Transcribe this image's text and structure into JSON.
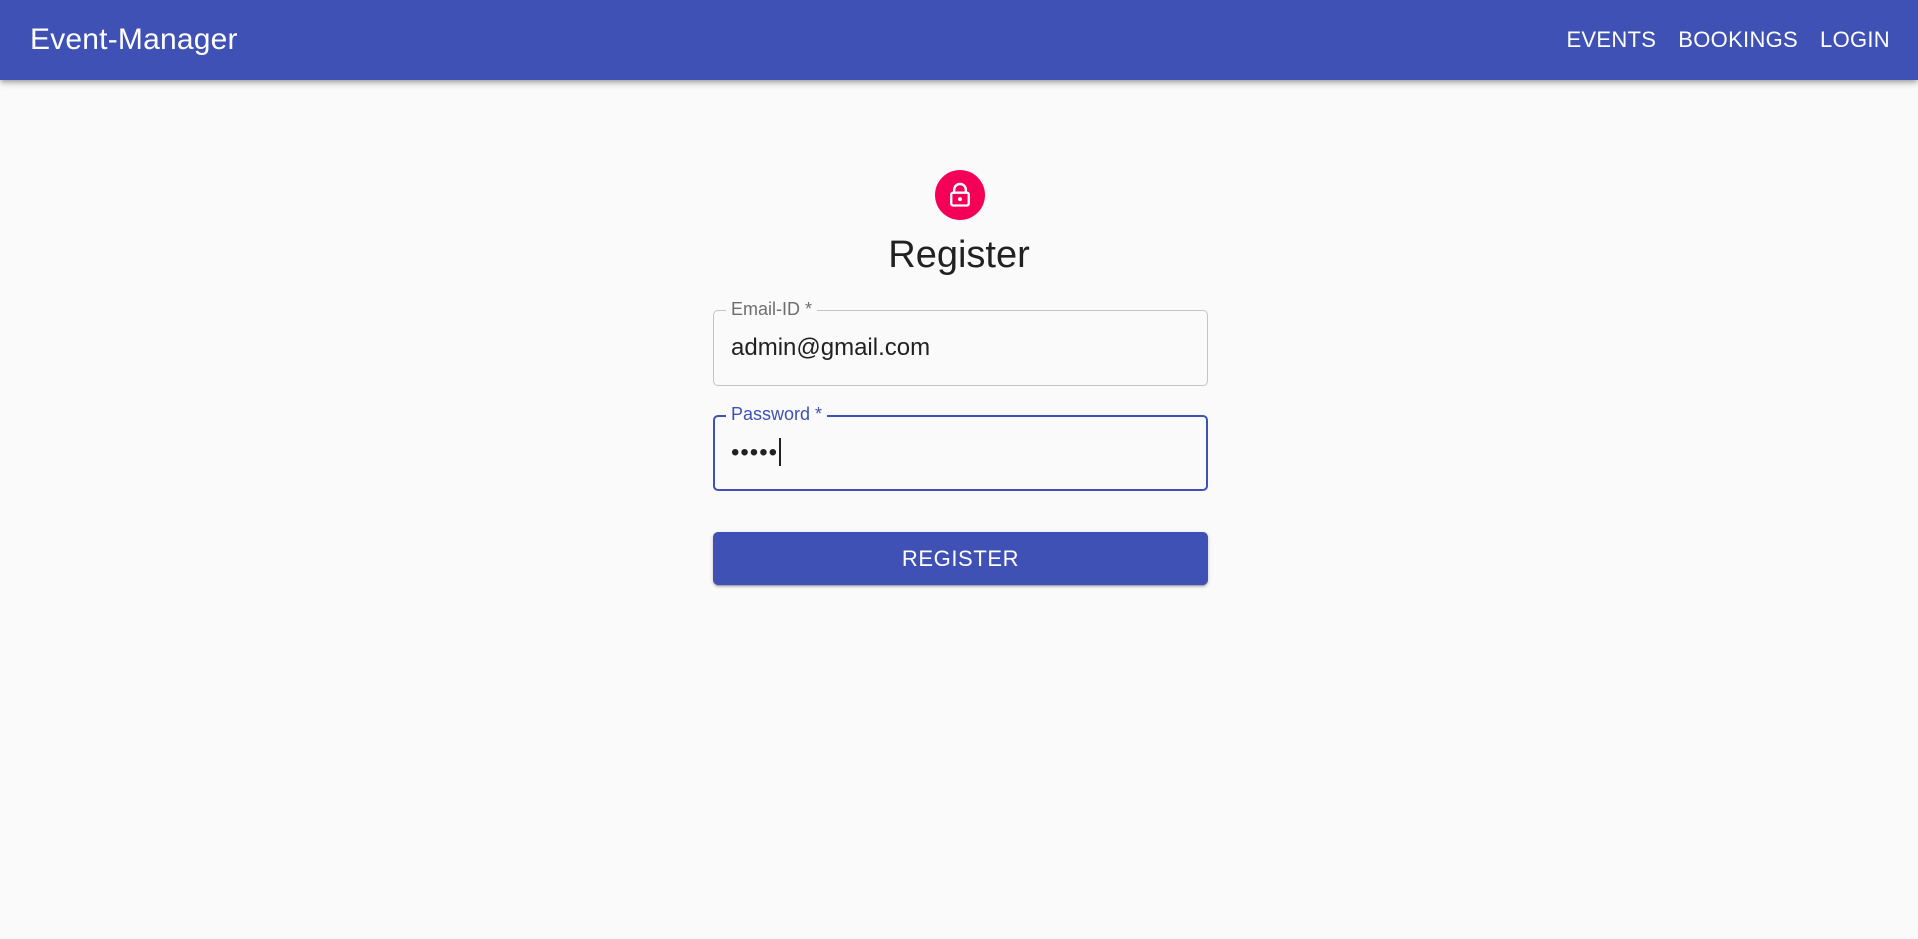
{
  "app": {
    "title": "Event-Manager",
    "brand_color": "#3f51b5"
  },
  "nav": {
    "items": [
      {
        "label": "EVENTS"
      },
      {
        "label": "BOOKINGS"
      },
      {
        "label": "LOGIN"
      }
    ]
  },
  "form": {
    "icon": "lock-icon",
    "icon_color": "#f50057",
    "title": "Register",
    "email": {
      "label": "Email-ID *",
      "value": "admin@gmail.com"
    },
    "password": {
      "label": "Password *",
      "value": "•••••",
      "focused": true
    },
    "submit_label": "REGISTER"
  }
}
